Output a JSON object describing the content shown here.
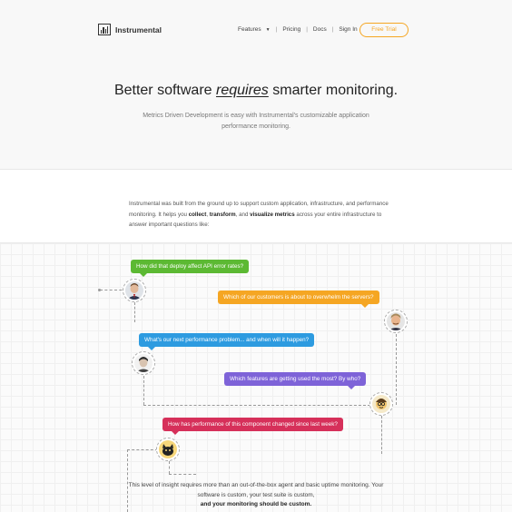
{
  "header": {
    "logo_text": "Instrumental",
    "menu": [
      "Features",
      "Pricing",
      "Docs",
      "Sign In"
    ],
    "trial_button": "Free Trial"
  },
  "hero": {
    "title_before": "Better software ",
    "title_em": "requires",
    "title_after": " smarter monitoring.",
    "subtitle": "Metrics Driven Development is easy with Instrumental's customizable application performance monitoring."
  },
  "intro": {
    "text_before": "Instrumental was built from the ground up to support custom application, infrastructure, and performance monitoring. It helps you ",
    "collect": "collect",
    "sep1": ", ",
    "transform": "transform",
    "sep2": ", and ",
    "visualize": "visualize metrics",
    "text_after": " across your entire infrastructure to answer important questions like:"
  },
  "questions": [
    {
      "text": "How did that deploy affect API error rates?",
      "color": "#5cb933"
    },
    {
      "text": "Which of our customers is about to overwhelm the servers?",
      "color": "#f5a623"
    },
    {
      "text": "What's our next performance problem... and when will it happen?",
      "color": "#2d9be0"
    },
    {
      "text": "Which features are getting used the most? By who?",
      "color": "#7e63d8"
    },
    {
      "text": "How has performance of this component changed since last week?",
      "color": "#d6305a"
    }
  ],
  "outro": {
    "text": "This level of insight requires more than an out-of-the-box agent and basic uptime monitoring. Your software is custom, your test suite is custom,",
    "bold": "and your monitoring should be custom."
  }
}
